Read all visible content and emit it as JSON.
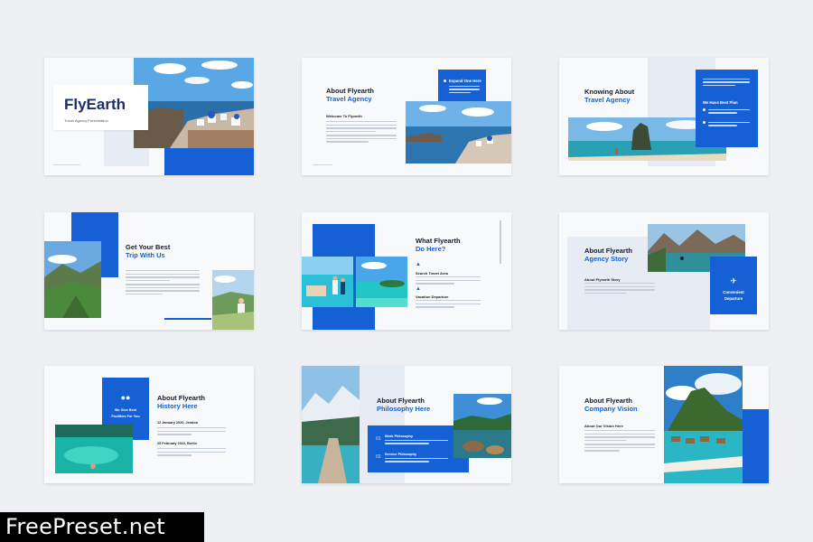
{
  "colors": {
    "accent": "#1560d4",
    "text": "#141c2b",
    "bg": "#eef0f3"
  },
  "slide1": {
    "brand": "FlyEarth",
    "subtitle": "Travel Agency Presentation"
  },
  "slide2": {
    "title": "About Flyearth",
    "title_blue": "Travel Agency",
    "welcome": "Welcome To Flyearth",
    "box_items": [
      "Expand One Here",
      "Expand Two Here"
    ]
  },
  "slide3": {
    "title": "Knowing About",
    "title_blue": "Travel Agency",
    "box_items": [
      "We Have Best Plan"
    ]
  },
  "slide4": {
    "title": "Get Your Best",
    "title_blue": "Trip With Us"
  },
  "slide5": {
    "title": "What Flyearth",
    "title_blue": "Do Here?",
    "items": [
      "Search Travel Area",
      "Vacation Departure"
    ]
  },
  "slide6": {
    "title": "About Flyearth",
    "title_blue": "Agency Story",
    "sub": "About Flyearth Story",
    "box_label_1": "Convenient",
    "box_label_2": "Departure"
  },
  "slide7": {
    "title": "About Flyearth",
    "title_blue": "History Here",
    "box_label_1": "We Give Best",
    "box_label_2": "Facilities For You",
    "date1": "12 January 2020, Jeraton",
    "date2": "25 February 2022, Berlin"
  },
  "slide8": {
    "title": "About Flyearth",
    "title_blue": "Philosophy Here",
    "items": [
      "Work Philosophy",
      "Service Philosophy"
    ],
    "nums": [
      "01",
      "02"
    ]
  },
  "slide9": {
    "title": "About Flyearth",
    "title_blue": "Company Vision",
    "sub": "About Our Vision Here"
  },
  "watermark": "FreePreset.net"
}
